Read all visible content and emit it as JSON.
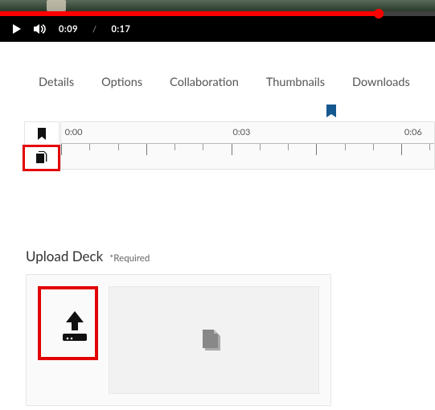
{
  "player": {
    "current_time": "0:09",
    "duration": "0:17",
    "progress_pct": 87
  },
  "tabs": [
    "Details",
    "Options",
    "Collaboration",
    "Thumbnails",
    "Downloads"
  ],
  "timeline": {
    "labels": [
      {
        "text": "0:00",
        "pct": 1
      },
      {
        "text": "0:03",
        "pct": 46
      },
      {
        "text": "0:06",
        "pct": 92
      }
    ],
    "bookmark_pct": 71
  },
  "upload": {
    "title": "Upload Deck",
    "required_label": "*Required"
  }
}
